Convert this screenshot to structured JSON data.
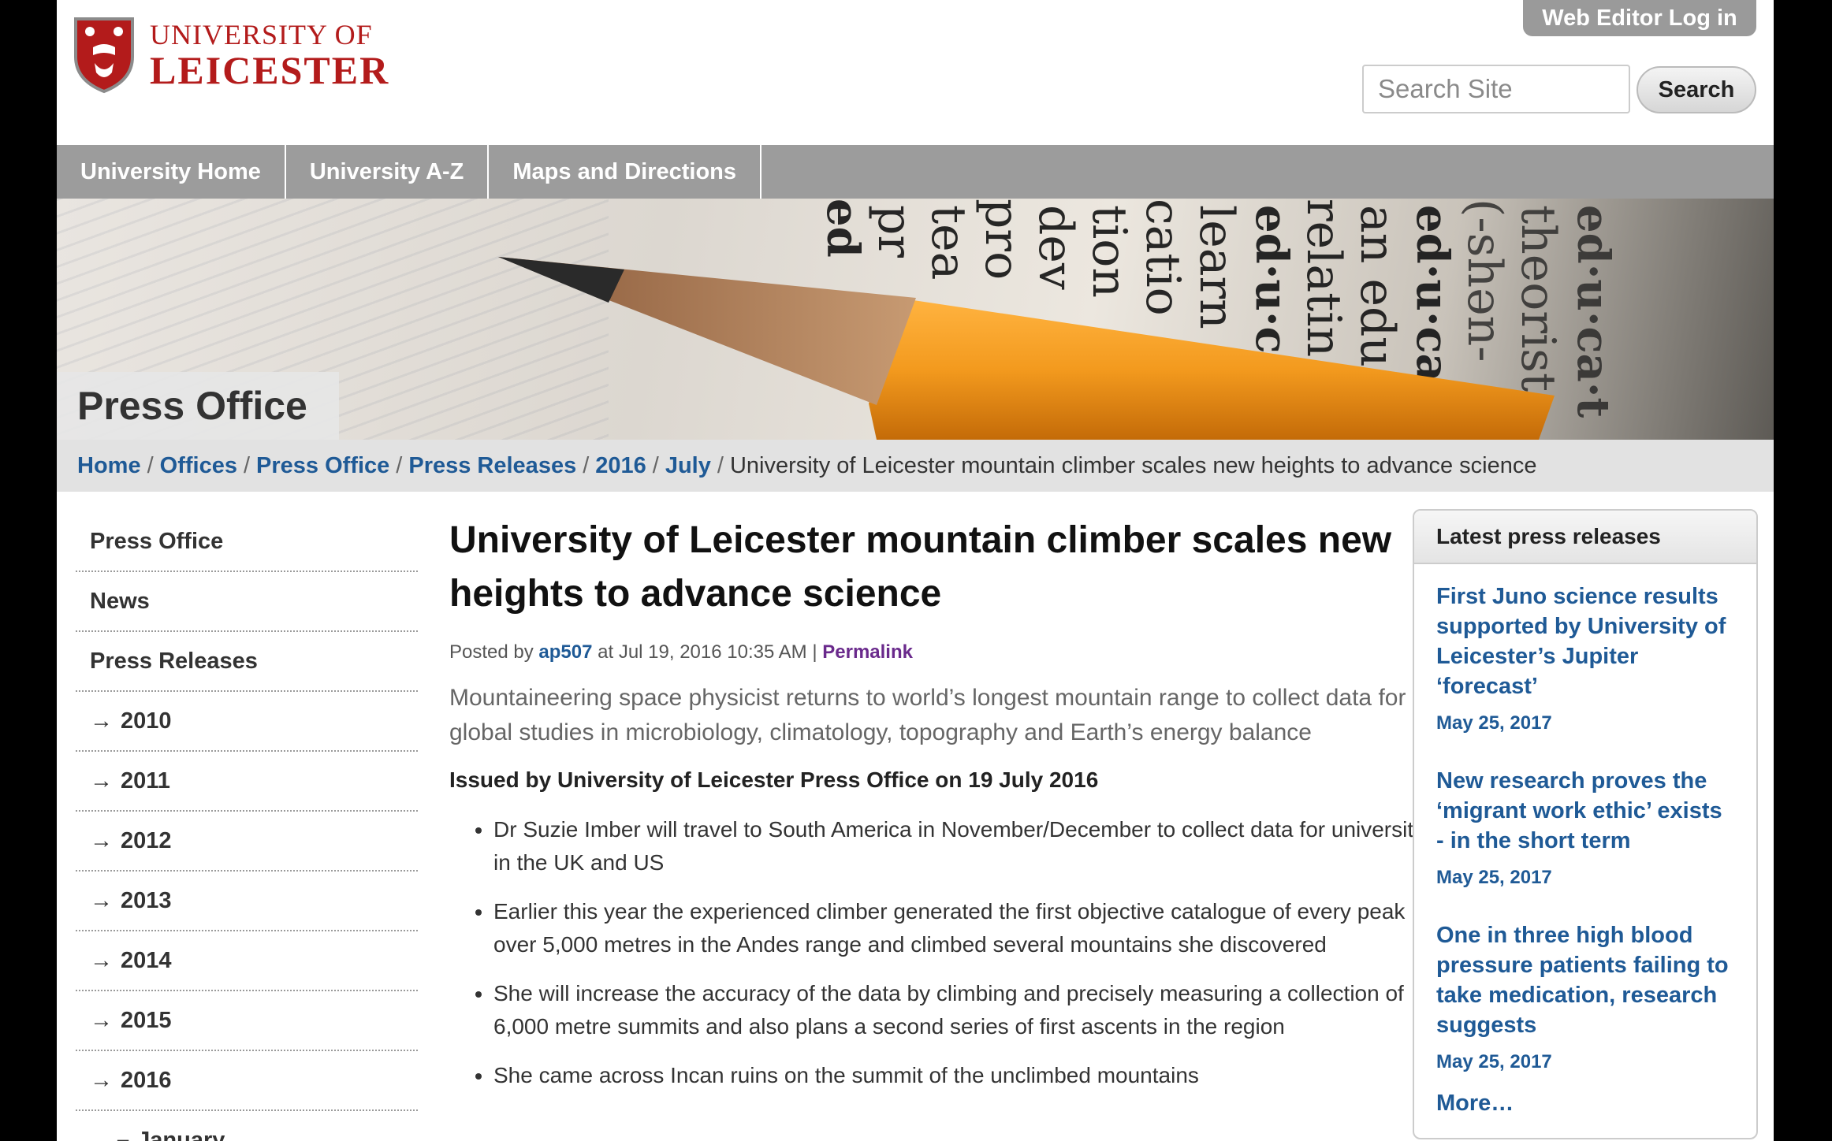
{
  "header": {
    "logo_line1": "UNIVERSITY OF",
    "logo_line2": "LEICESTER",
    "web_editor_label": "Web Editor Log in",
    "search_placeholder": "Search Site",
    "search_button": "Search"
  },
  "topnav": {
    "items": [
      "University Home",
      "University A-Z",
      "Maps and Directions"
    ]
  },
  "banner": {
    "title": "Press Office",
    "dictionary_words": [
      "ed",
      "pr",
      "tea",
      "pro",
      "dev",
      "tion",
      "catio",
      "learn",
      "ed·u·c",
      "relatin",
      "an edu",
      "ed·u·ca",
      "(-shən-",
      "theorist",
      "ed·u·ca·t"
    ]
  },
  "breadcrumb": {
    "links": [
      "Home",
      "Offices",
      "Press Office",
      "Press Releases",
      "2016",
      "July"
    ],
    "separator": "/",
    "current": "University of Leicester mountain climber scales new heights to advance science"
  },
  "leftnav": {
    "items": [
      {
        "arrow": "",
        "label": "Press Office"
      },
      {
        "arrow": "",
        "label": "News"
      },
      {
        "arrow": "",
        "label": "Press Releases"
      },
      {
        "arrow": "→",
        "label": "2010"
      },
      {
        "arrow": "→",
        "label": "2011"
      },
      {
        "arrow": "→",
        "label": "2012"
      },
      {
        "arrow": "→",
        "label": "2013"
      },
      {
        "arrow": "→",
        "label": "2014"
      },
      {
        "arrow": "→",
        "label": "2015"
      },
      {
        "arrow": "→",
        "label": "2016"
      }
    ],
    "sub_item": {
      "arrow": "–",
      "label": "January"
    }
  },
  "article": {
    "title": "University of Leicester mountain climber scales new heights to advance science",
    "posted_by_prefix": "Posted by",
    "author": "ap507",
    "posted_at": "at Jul 19, 2016 10:35 AM |",
    "permalink": "Permalink",
    "lead": "Mountaineering space physicist returns to world’s longest mountain range to collect data for global studies in microbiology, climatology, topography and Earth’s energy balance",
    "issued": "Issued by University of Leicester Press Office on 19 July 2016",
    "bullets": [
      "Dr Suzie Imber will travel to South America in November/December to collect data for universities in the UK and US",
      "Earlier this year the experienced climber generated the first objective catalogue of every peak over 5,000 metres in the Andes range and climbed several mountains she discovered",
      "She will increase the accuracy of the data by climbing and precisely measuring a collection of 6,000 metre summits and also plans a second series of first ascents in the region",
      "She came across Incan ruins on the summit of the unclimbed mountains"
    ]
  },
  "sidebar": {
    "heading": "Latest press releases",
    "releases": [
      {
        "title": "First Juno science results supported by University of Leicester’s Jupiter ‘forecast’",
        "date": "May 25, 2017"
      },
      {
        "title": "New research proves the ‘migrant work ethic’ exists - in the short term",
        "date": "May 25, 2017"
      },
      {
        "title": "One in three high blood pressure patients failing to take medication, research suggests",
        "date": "May 25, 2017"
      }
    ],
    "more": "More…"
  },
  "colors": {
    "brand_red": "#b31b1b",
    "link_blue": "#1f5a96",
    "nav_gray": "#9c9c9c",
    "permalink_purple": "#6a2a8c",
    "pencil_orange": "#f39a1e"
  },
  "icons": {
    "logo": "university-shield-icon"
  }
}
